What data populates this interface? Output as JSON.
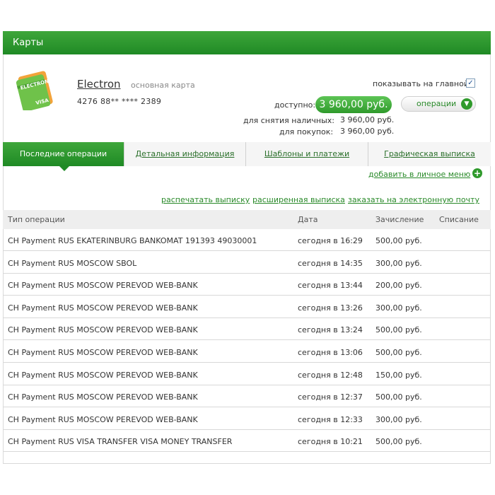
{
  "header": {
    "title": "Карты"
  },
  "card": {
    "name": "Electron",
    "type": "основная карта",
    "number": "4276 88** **** 2389",
    "icon_text": "ELECTRON",
    "icon_brand": "VISA",
    "show_on_main_label": "показывать на главной",
    "show_on_main_checked": true,
    "available_label": "доступно:",
    "available_value": "3 960,00 руб.",
    "operations_button": "операции",
    "cash_label": "для снятия наличных:",
    "cash_value": "3 960,00 руб.",
    "purchases_label": "для покупок:",
    "purchases_value": "3 960,00 руб."
  },
  "tabs": [
    {
      "label": "Последние операции",
      "active": true
    },
    {
      "label": "Детальная информация",
      "active": false
    },
    {
      "label": "Шаблоны и платежи",
      "active": false
    },
    {
      "label": "Графическая выписка",
      "active": false
    }
  ],
  "actions": {
    "add_to_menu": "добавить в личное меню",
    "print": "распечатать выписку",
    "extended": "расширенная выписка",
    "email": "заказать на электронную почту"
  },
  "table": {
    "columns": [
      "Тип операции",
      "Дата",
      "Зачисление",
      "Списание"
    ],
    "rows": [
      {
        "type": "CH Payment RUS EKATERINBURG BANKOMAT 191393 49030001",
        "date": "сегодня в 16:29",
        "credit": "500,00 руб.",
        "debit": ""
      },
      {
        "type": "CH Payment RUS MOSCOW SBOL",
        "date": "сегодня в 14:35",
        "credit": "300,00 руб.",
        "debit": ""
      },
      {
        "type": "CH Payment RUS MOSCOW PEREVOD WEB-BANK",
        "date": "сегодня в 13:44",
        "credit": "200,00 руб.",
        "debit": ""
      },
      {
        "type": "CH Payment RUS MOSCOW PEREVOD WEB-BANK",
        "date": "сегодня в 13:26",
        "credit": "300,00 руб.",
        "debit": ""
      },
      {
        "type": "CH Payment RUS MOSCOW PEREVOD WEB-BANK",
        "date": "сегодня в 13:24",
        "credit": "500,00 руб.",
        "debit": ""
      },
      {
        "type": "CH Payment RUS MOSCOW PEREVOD WEB-BANK",
        "date": "сегодня в 13:06",
        "credit": "500,00 руб.",
        "debit": ""
      },
      {
        "type": "CH Payment RUS MOSCOW PEREVOD WEB-BANK",
        "date": "сегодня в 12:48",
        "credit": "150,00 руб.",
        "debit": ""
      },
      {
        "type": "CH Payment RUS MOSCOW PEREVOD WEB-BANK",
        "date": "сегодня в 12:37",
        "credit": "500,00 руб.",
        "debit": ""
      },
      {
        "type": "CH Payment RUS MOSCOW PEREVOD WEB-BANK",
        "date": "сегодня в 12:33",
        "credit": "300,00 руб.",
        "debit": ""
      },
      {
        "type": "CH Payment RUS VISA TRANSFER VISA MONEY TRANSFER",
        "date": "сегодня в 10:21",
        "credit": "500,00 руб.",
        "debit": ""
      }
    ]
  },
  "colors": {
    "brand_green": "#1f8a25",
    "link_green": "#2a8a2a",
    "pill_green": "#3fae3a"
  },
  "icons": [
    "card-icon",
    "checkbox-checked-icon",
    "chevron-down-icon",
    "plus-icon"
  ]
}
